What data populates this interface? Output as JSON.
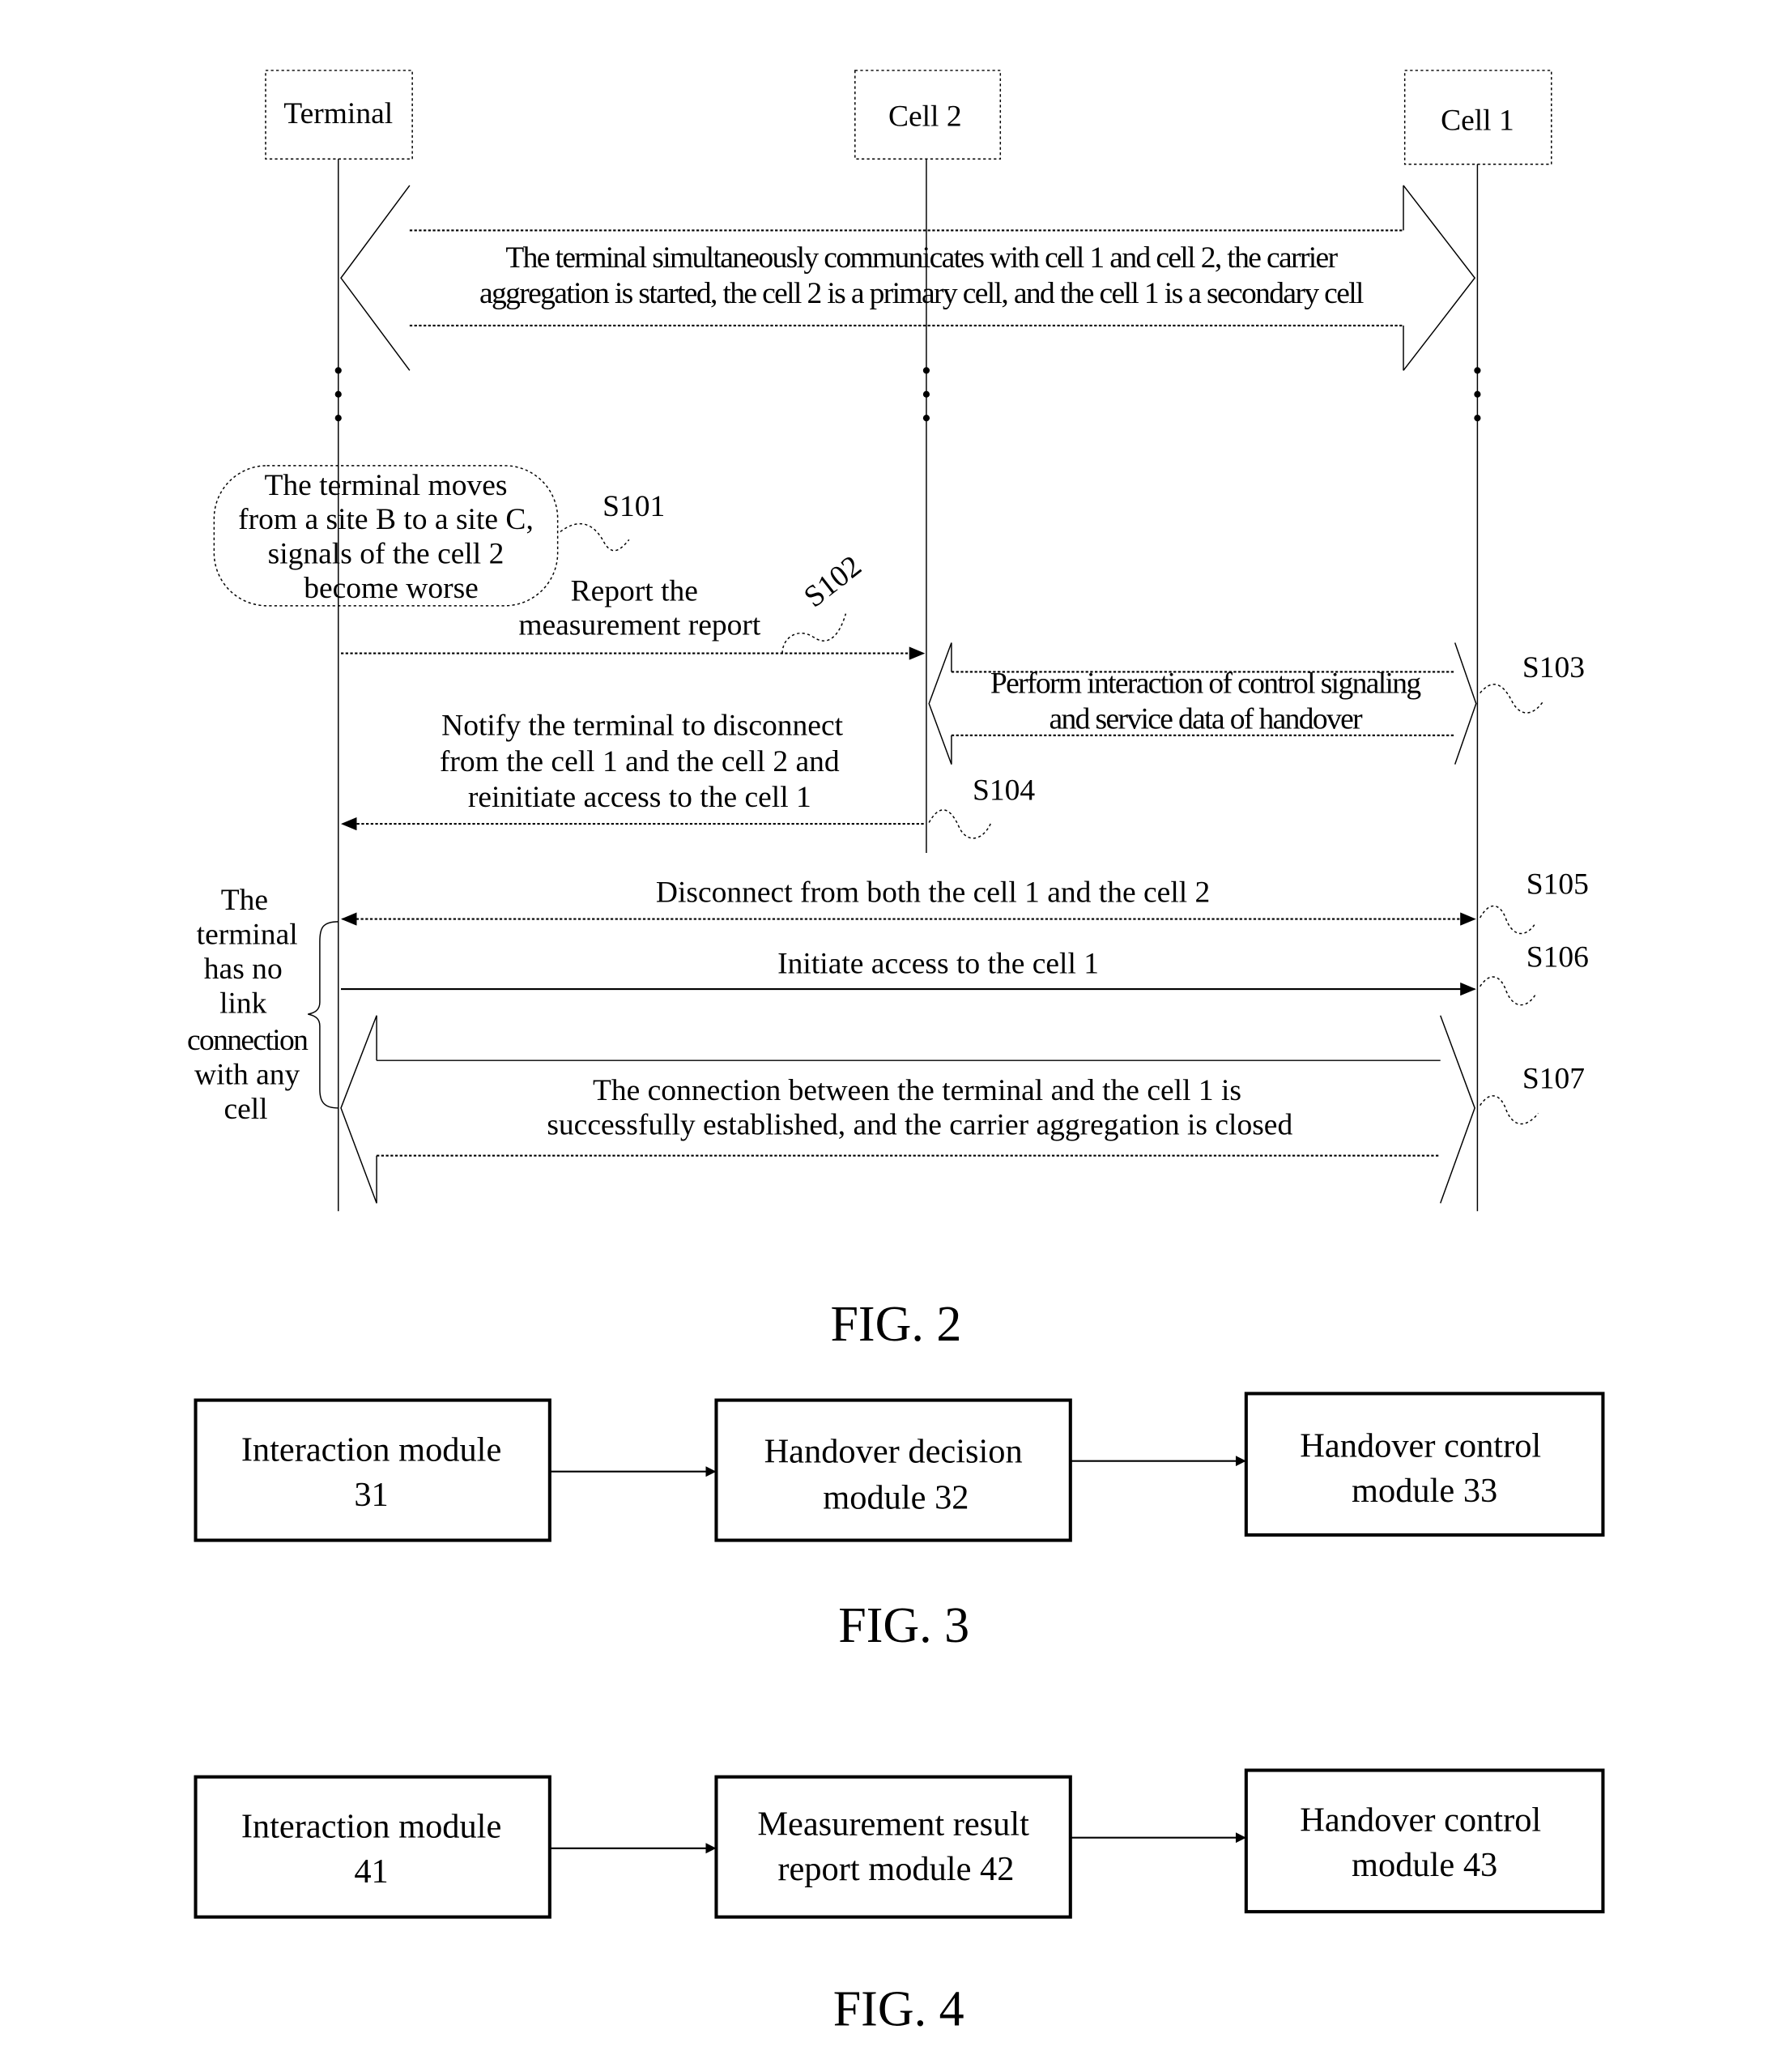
{
  "fig2": {
    "caption": "FIG. 2",
    "participants": [
      "Terminal",
      "Cell 2",
      "Cell 1"
    ],
    "ca_banner": [
      "The terminal simultaneously communicates with cell 1 and cell 2, the carrier",
      "aggregation is started, the cell 2 is a primary cell, and the cell 1 is a secondary cell"
    ],
    "s101_note": [
      "The terminal moves",
      "from a site B to a site C,",
      "signals of the cell 2",
      "become worse"
    ],
    "s102_msg": [
      "Report the",
      "measurement report"
    ],
    "s103_msg": [
      "Perform interaction of control signaling",
      "and service data of handover"
    ],
    "s104_msg": [
      "Notify the terminal to disconnect",
      "from the cell 1 and the cell 2 and",
      "reinitiate access to the cell 1"
    ],
    "s105_msg": "Disconnect from both the cell 1 and the cell 2",
    "s106_msg": "Initiate access to the cell 1",
    "s107_msg": [
      "The connection between the terminal and the cell 1 is",
      "successfully established, and the carrier aggregation is closed"
    ],
    "side_note": [
      "The",
      "terminal",
      "has no",
      "link",
      "connection",
      "with any",
      "cell"
    ],
    "steps": [
      "S101",
      "S102",
      "S103",
      "S104",
      "S105",
      "S106",
      "S107"
    ]
  },
  "fig3": {
    "caption": "FIG. 3",
    "modules": [
      [
        "Interaction module",
        "31"
      ],
      [
        "Handover decision",
        "module 32"
      ],
      [
        "Handover control",
        "module 33"
      ]
    ]
  },
  "fig4": {
    "caption": "FIG. 4",
    "modules": [
      [
        "Interaction module",
        "41"
      ],
      [
        "Measurement result",
        "report module 42"
      ],
      [
        "Handover control",
        "module 43"
      ]
    ]
  }
}
